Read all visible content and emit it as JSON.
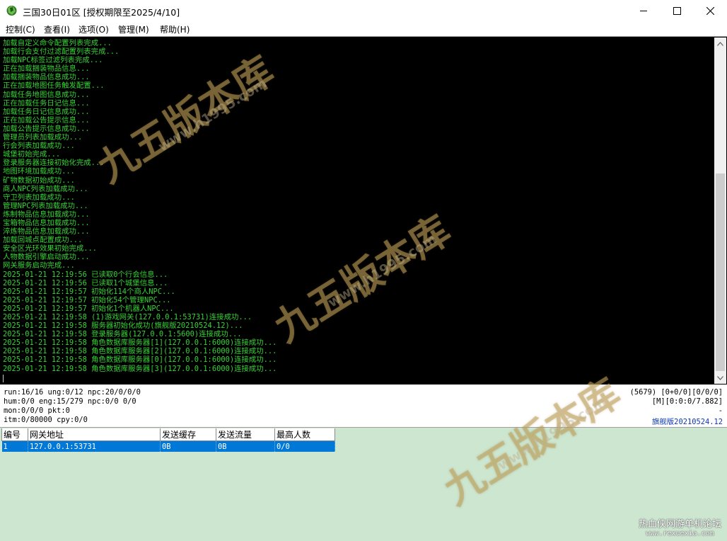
{
  "window": {
    "title": "三国30日01区 [授权期限至2025/4/10]",
    "minimize_icon": "minimize-icon",
    "maximize_icon": "maximize-icon",
    "close_icon": "close-icon"
  },
  "menu": {
    "items": [
      "控制(C)",
      "查看(I)",
      "选项(O)",
      "管理(M)",
      "帮助(H)"
    ]
  },
  "console": {
    "lines": [
      "加载自定义命令配置列表完成...",
      "加载行会支付过滤配置列表完成...",
      "加载NPC标签过滤列表完成...",
      "正在加载捆装物品信息...",
      "加载捆装物品信息成功...",
      "正在加载地图任务触发配置...",
      "加载任务地图信息成功...",
      "正在加载任务日记信息...",
      "加载任务日记信息成功...",
      "正在加载公告提示信息...",
      "加载公告提示信息成功...",
      "管理员列表加载成功...",
      "行会列表加载成功...",
      "城堡初始完成...",
      "登录服务器连接初始化完成...",
      "地图环境加载成功...",
      "矿物数据初始成功...",
      "商人NPC列表加载成功...",
      "守卫列表加载成功...",
      "管理NPC列表加载成功...",
      "炼制物品信息加载成功...",
      "宝箱物品信息加载成功...",
      "淬炼物品信息加载成功...",
      "加载回城点配置成功...",
      "安全区光环效果初始完成...",
      "人物数据引擎启动成功...",
      "网关服务启动完成...",
      "2025-01-21 12:19:56 已读取0个行会信息...",
      "2025-01-21 12:19:56 已读取1个城堡信息...",
      "2025-01-21 12:19:57 初始化114个商人NPC...",
      "2025-01-21 12:19:57 初始化54个管理NPC...",
      "2025-01-21 12:19:57 初始化1个机器人NPC...",
      "2025-01-21 12:19:58 (1)游戏网关(127.0.0.1:53731)连接成功...",
      "2025-01-21 12:19:58 服务器初始化成功(旗舰版20210524.12)...",
      "2025-01-21 12:19:58 登录服务器(127.0.0.1:5600)连接成功...",
      "2025-01-21 12:19:58 角色数据库服务器[1](127.0.0.1:6000)连接成功...",
      "2025-01-21 12:19:58 角色数据库服务器[2](127.0.0.1:6000)连接成功...",
      "2025-01-21 12:19:58 角色数据库服务器[0](127.0.0.1:6000)连接成功...",
      "2025-01-21 12:19:58 角色数据库服务器[3](127.0.0.1:6000)连接成功..."
    ],
    "text_color": "#35d335",
    "background": "#000000"
  },
  "status": {
    "left": [
      "run:16/16 ung:0/12 npc:20/0/0/0",
      "hum:0/0 eng:15/279 npc:0/0 0/0",
      "mon:0/0/0 pkt:0",
      "itm:0/80000 cpy:0/0"
    ],
    "right": [
      "(5679) [0+0/0][0/0/0]",
      "[M][0:0:0/7.882]",
      "-",
      "旗舰版20210524.12"
    ],
    "edition_color": "#0b38b4"
  },
  "gateway_table": {
    "headers": [
      "编号",
      "网关地址",
      "发送缓存",
      "发送流量",
      "最高人数"
    ],
    "rows": [
      [
        "1",
        "127.0.0.1:53731",
        "0B",
        "0B",
        "0/0"
      ]
    ],
    "selected_color": "#0078d7"
  },
  "watermark": {
    "brand": "九五版本库",
    "url": "www.h1995.com",
    "corner_name": "热血侠网游单机论坛",
    "corner_url": "www.rexuexia.com"
  }
}
